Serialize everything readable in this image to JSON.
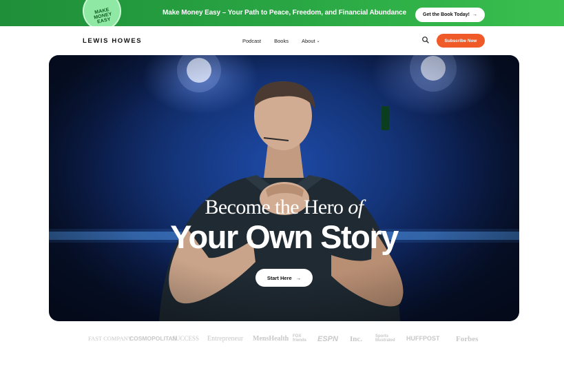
{
  "promo": {
    "badge_text": "MAKE\nMONEY\nEASY",
    "text": "Make Money Easy – Your Path to Peace, Freedom, and Financial Abundance",
    "cta_label": "Get the Book Today!",
    "cta_arrow": "→",
    "color": "#2aa844"
  },
  "nav": {
    "brand": "LEWIS HOWES",
    "links": [
      {
        "label": "Podcast"
      },
      {
        "label": "Books"
      },
      {
        "label": "About",
        "chevron": "⌄"
      }
    ],
    "search_icon": "search-icon",
    "subscribe_label": "Subscribe Now",
    "accent": "#f05a28"
  },
  "hero": {
    "headline_line1_main": "Become the Hero",
    "headline_line1_italic": "of",
    "headline_line2": "Your Own Story",
    "button_label": "Start Here",
    "button_arrow": "→"
  },
  "press": {
    "logos": [
      {
        "text": "FAST COMPANY"
      },
      {
        "text": "COSMOPOLITAN"
      },
      {
        "text": "SUCCESS"
      },
      {
        "text": "Entrepreneur"
      },
      {
        "text": "MensHealth"
      },
      {
        "text": "FOX friends"
      },
      {
        "text": "ESPN"
      },
      {
        "text": "Inc."
      },
      {
        "text": "Sports Illustrated"
      },
      {
        "text": "HUFFPOST"
      },
      {
        "text": "Forbes"
      }
    ]
  }
}
